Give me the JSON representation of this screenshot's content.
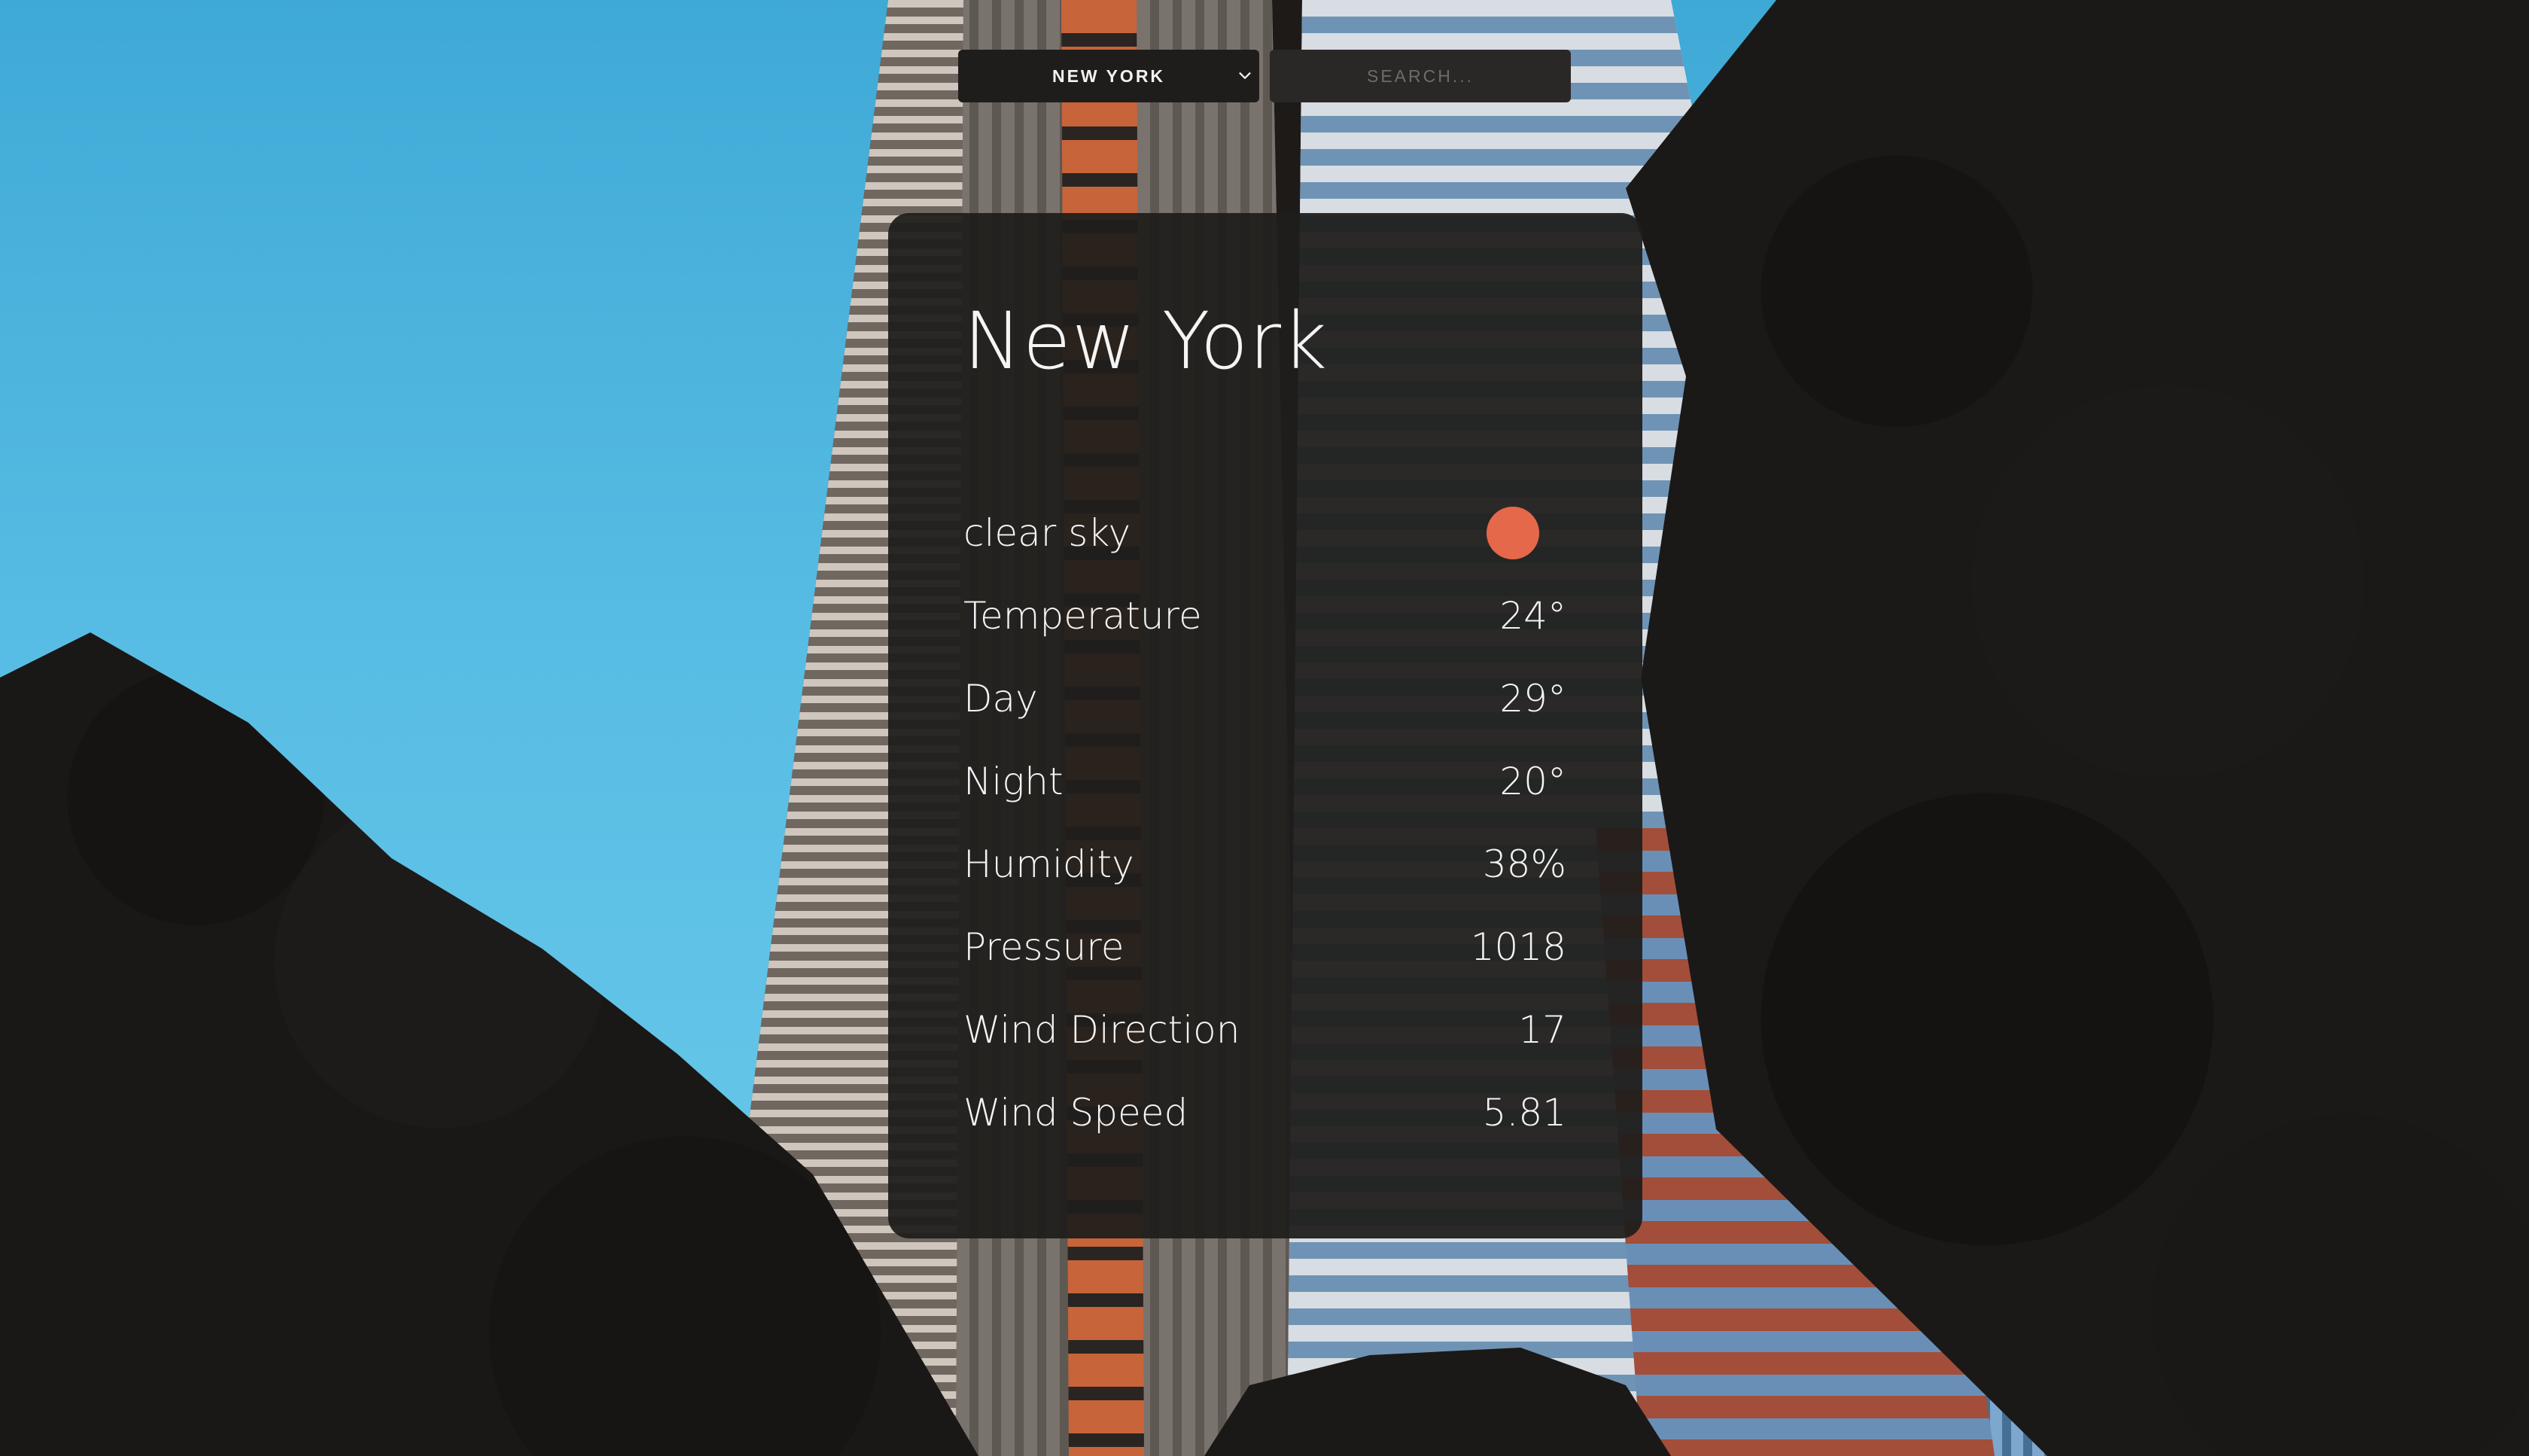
{
  "controls": {
    "city_select": {
      "selected": "NEW YORK"
    },
    "search": {
      "placeholder": "SEARCH..."
    }
  },
  "weather": {
    "city": "New York",
    "condition": "clear sky",
    "condition_icon": "sun-icon",
    "sun_color": "#e5684a",
    "rows": [
      {
        "label": "Temperature",
        "value": "24°"
      },
      {
        "label": "Day",
        "value": "29°"
      },
      {
        "label": "Night",
        "value": "20°"
      },
      {
        "label": "Humidity",
        "value": "38%"
      },
      {
        "label": "Pressure",
        "value": "1018"
      },
      {
        "label": "Wind Direction",
        "value": "17"
      },
      {
        "label": "Wind Speed",
        "value": "5.81"
      }
    ]
  }
}
